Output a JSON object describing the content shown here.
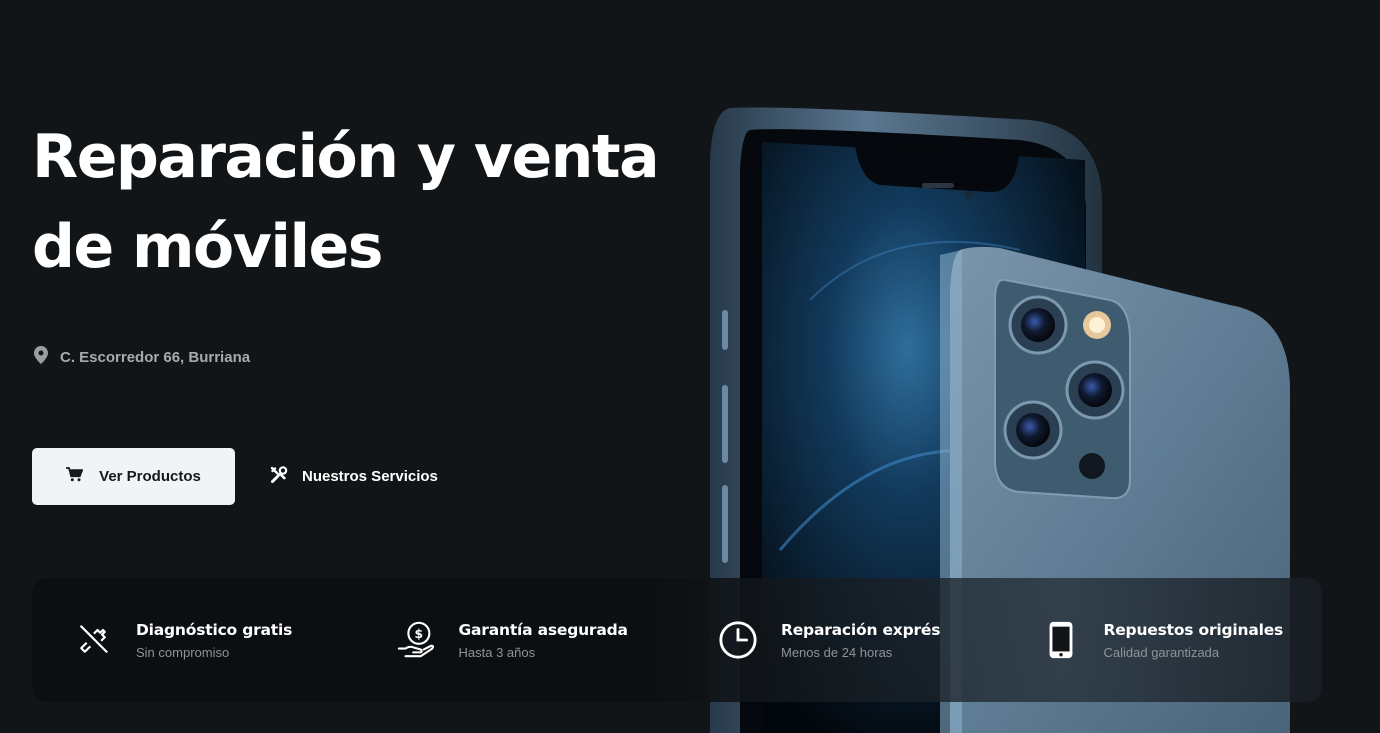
{
  "hero": {
    "title_line1": "Reparación y venta",
    "title_line2": "de móviles",
    "address": "C. Escorredor 66, Burriana",
    "address_icon": "map-pin-icon"
  },
  "actions": {
    "primary_label": "Ver Productos",
    "primary_icon": "cart-icon",
    "secondary_label": "Nuestros Servicios",
    "secondary_icon": "tools-icon"
  },
  "features": [
    {
      "icon": "diagnostic-tools-icon",
      "title": "Diagnóstico gratis",
      "subtitle": "Sin compromiso"
    },
    {
      "icon": "money-hand-icon",
      "title": "Garantía asegurada",
      "subtitle": "Hasta 3 años"
    },
    {
      "icon": "clock-icon",
      "title": "Reparación exprés",
      "subtitle": "Menos de 24 horas"
    },
    {
      "icon": "smartphone-icon",
      "title": "Repuestos originales",
      "subtitle": "Calidad garantizada"
    }
  ],
  "colors": {
    "background": "#121518",
    "primary_button": "#f2f3f5",
    "muted_text": "#a7abb0",
    "phone_blue": "#4a6b85"
  }
}
